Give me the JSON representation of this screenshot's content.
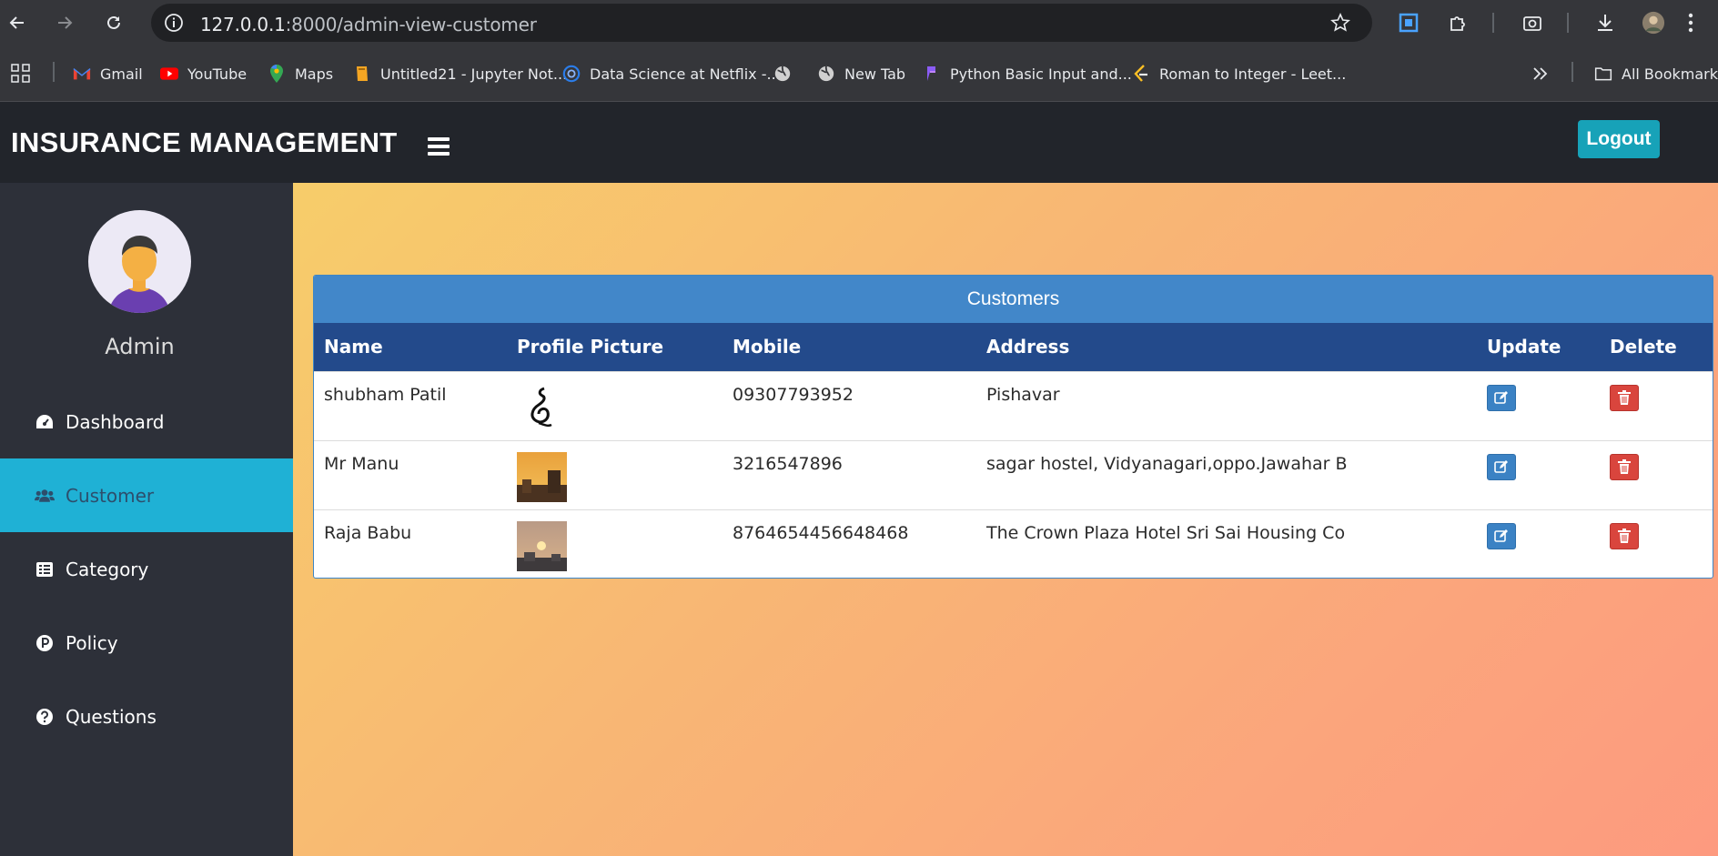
{
  "browser": {
    "url_host": "127.0.0.1",
    "url_path": ":8000/admin-view-customer",
    "bookmarks": [
      {
        "label": "Gmail",
        "icon": "gmail-icon"
      },
      {
        "label": "YouTube",
        "icon": "youtube-icon"
      },
      {
        "label": "Maps",
        "icon": "maps-icon"
      },
      {
        "label": "Untitled21 - Jupyter Not...",
        "icon": "jupyter-icon"
      },
      {
        "label": "Data Science at Netflix -...",
        "icon": "site-icon"
      },
      {
        "label": "",
        "icon": "globe-icon"
      },
      {
        "label": "New Tab",
        "icon": "globe-icon"
      },
      {
        "label": "Python Basic Input and...",
        "icon": "site-icon"
      },
      {
        "label": "Roman to Integer - Leet...",
        "icon": "leetcode-icon"
      }
    ],
    "all_bookmarks": "All Bookmarks"
  },
  "header": {
    "brand": "INSURANCE MANAGEMENT",
    "logout": "Logout"
  },
  "sidebar": {
    "user": "Admin",
    "items": [
      {
        "label": "Dashboard",
        "icon": "dashboard-icon",
        "active": false
      },
      {
        "label": "Customer",
        "icon": "users-icon",
        "active": true
      },
      {
        "label": "Category",
        "icon": "list-icon",
        "active": false
      },
      {
        "label": "Policy",
        "icon": "policy-icon",
        "active": false
      },
      {
        "label": "Questions",
        "icon": "question-icon",
        "active": false
      }
    ]
  },
  "customers": {
    "title": "Customers",
    "columns": [
      "Name",
      "Profile Picture",
      "Mobile",
      "Address",
      "Update",
      "Delete"
    ],
    "rows": [
      {
        "name": "shubham Patil",
        "mobile": "09307793952",
        "address": "Pishavar"
      },
      {
        "name": "Mr Manu",
        "mobile": "3216547896",
        "address": "sagar hostel, Vidyanagari,oppo.Jawahar B"
      },
      {
        "name": "Raja Babu",
        "mobile": "8764654456648468",
        "address": "The Crown Plaza Hotel Sri Sai Housing Co"
      }
    ]
  },
  "colors": {
    "accent": "#17a2b8",
    "table_head": "#234a8b",
    "card_head": "#4287c9",
    "update": "#3b82c4",
    "delete": "#d9453d"
  }
}
